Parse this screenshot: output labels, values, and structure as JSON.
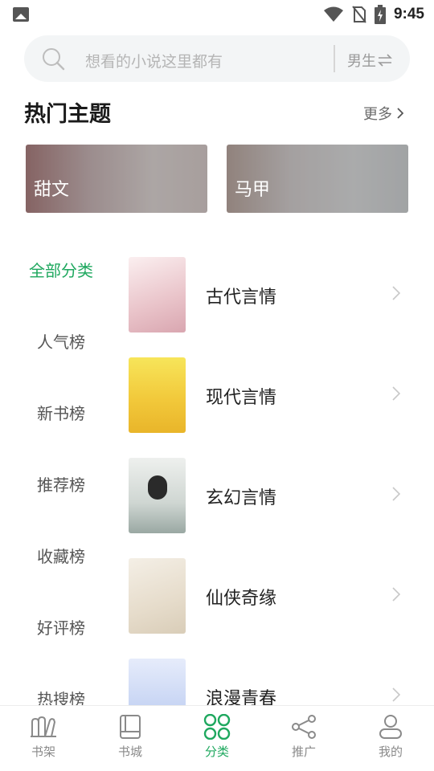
{
  "status_bar": {
    "time": "9:45",
    "icons": [
      "image-icon",
      "wifi-icon",
      "no-sim-icon",
      "battery-charging-icon"
    ]
  },
  "search": {
    "placeholder": "想看的小说这里都有",
    "gender_label": "男生"
  },
  "hot_topics": {
    "title": "热门主题",
    "more_label": "更多",
    "banners": [
      {
        "label": "甜文"
      },
      {
        "label": "马甲"
      }
    ]
  },
  "side_nav": {
    "items": [
      {
        "label": "全部分类",
        "active": true
      },
      {
        "label": "人气榜"
      },
      {
        "label": "新书榜"
      },
      {
        "label": "推荐榜"
      },
      {
        "label": "收藏榜"
      },
      {
        "label": "好评榜"
      },
      {
        "label": "热搜榜"
      }
    ]
  },
  "categories": [
    {
      "name": "古代言情"
    },
    {
      "name": "现代言情"
    },
    {
      "name": "玄幻言情"
    },
    {
      "name": "仙侠奇缘"
    },
    {
      "name": "浪漫青春"
    }
  ],
  "bottom_nav": {
    "items": [
      {
        "label": "书架"
      },
      {
        "label": "书城"
      },
      {
        "label": "分类",
        "active": true
      },
      {
        "label": "推广"
      },
      {
        "label": "我的"
      }
    ]
  },
  "colors": {
    "accent": "#1fa85f",
    "text": "#222222",
    "muted": "#8a8a8a",
    "search_bg": "#f3f5f6"
  }
}
